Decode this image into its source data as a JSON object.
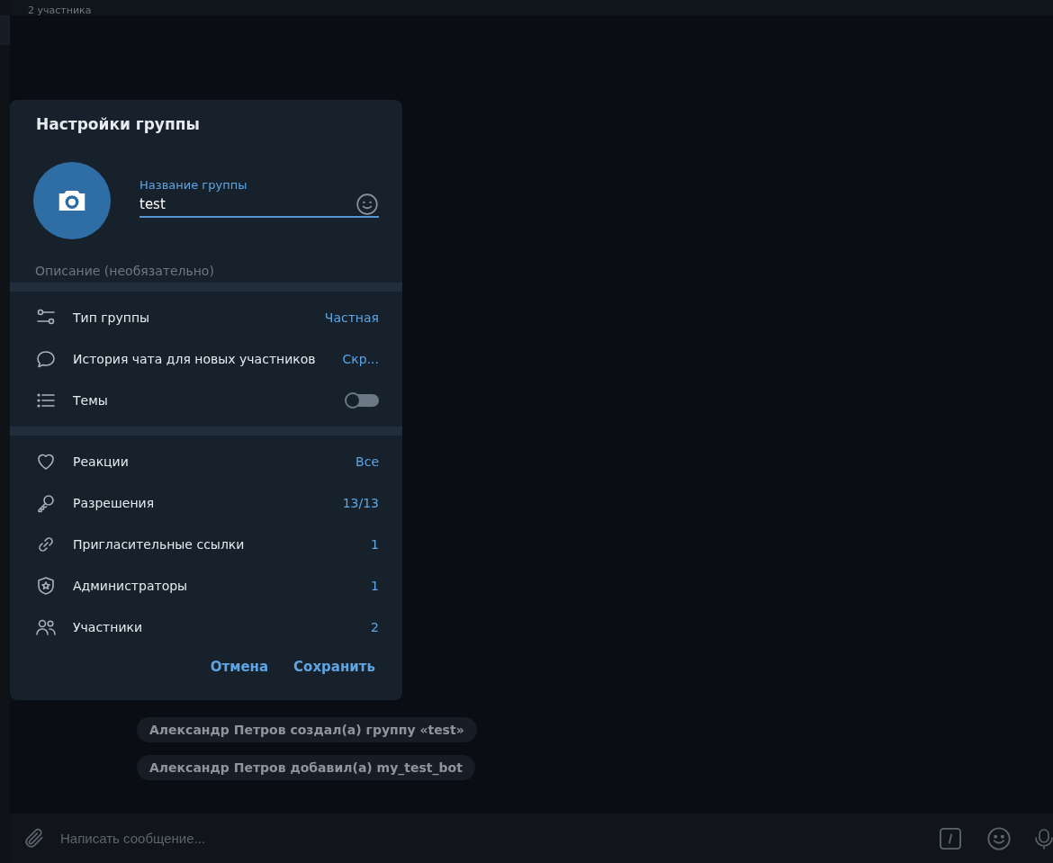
{
  "chat_header": {
    "subtitle": "2 участника"
  },
  "dialog": {
    "title": "Настройки группы",
    "name_field": {
      "label": "Название группы",
      "value": "test"
    },
    "description_field": {
      "placeholder": "Описание (необязательно)"
    },
    "sections": [
      {
        "items": [
          {
            "kind": "value",
            "label": "Тип группы",
            "value": "Частная"
          },
          {
            "kind": "value",
            "label": "История чата для новых участников",
            "value": "Скр..."
          },
          {
            "kind": "toggle",
            "label": "Темы",
            "on": false
          }
        ]
      },
      {
        "items": [
          {
            "kind": "value",
            "label": "Реакции",
            "value": "Все"
          },
          {
            "kind": "value",
            "label": "Разрешения",
            "value": "13/13"
          },
          {
            "kind": "value",
            "label": "Пригласительные ссылки",
            "value": "1"
          },
          {
            "kind": "value",
            "label": "Администраторы",
            "value": "1"
          },
          {
            "kind": "value",
            "label": "Участники",
            "value": "2"
          }
        ]
      }
    ],
    "buttons": [
      "Отмена",
      "Сохранить"
    ]
  },
  "service_messages": [
    "Александр Петров создал(а) группу «test»",
    "Александр Петров добавил(а) my_test_bot"
  ],
  "composer": {
    "placeholder": "Написать сообщение..."
  }
}
